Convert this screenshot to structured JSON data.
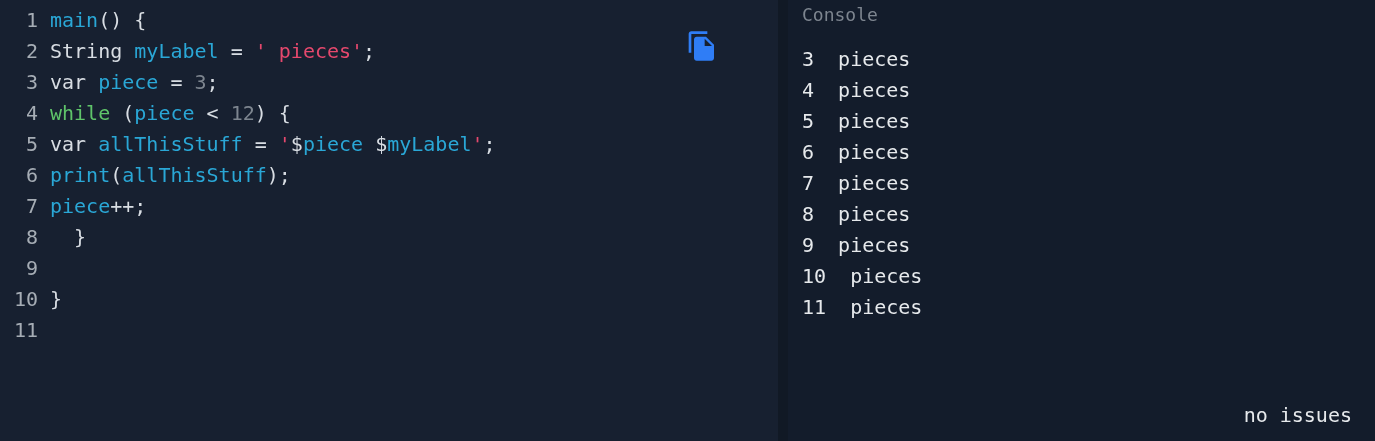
{
  "editor": {
    "lines": [
      {
        "number": "1",
        "tokens": [
          {
            "kind": "ident",
            "text": "main"
          },
          {
            "kind": "plain",
            "text": "() {"
          }
        ]
      },
      {
        "number": "2",
        "tokens": [
          {
            "kind": "plain",
            "text": "String "
          },
          {
            "kind": "ident",
            "text": "myLabel"
          },
          {
            "kind": "plain",
            "text": " = "
          },
          {
            "kind": "string",
            "text": "' pieces'"
          },
          {
            "kind": "plain",
            "text": ";"
          }
        ]
      },
      {
        "number": "3",
        "tokens": [
          {
            "kind": "plain",
            "text": "var "
          },
          {
            "kind": "ident",
            "text": "piece"
          },
          {
            "kind": "plain",
            "text": " = "
          },
          {
            "kind": "number",
            "text": "3"
          },
          {
            "kind": "plain",
            "text": ";"
          }
        ]
      },
      {
        "number": "4",
        "tokens": [
          {
            "kind": "keyword",
            "text": "while"
          },
          {
            "kind": "plain",
            "text": " ("
          },
          {
            "kind": "ident",
            "text": "piece"
          },
          {
            "kind": "plain",
            "text": " < "
          },
          {
            "kind": "number",
            "text": "12"
          },
          {
            "kind": "plain",
            "text": ") {"
          }
        ]
      },
      {
        "number": "5",
        "tokens": [
          {
            "kind": "plain",
            "text": "var "
          },
          {
            "kind": "ident",
            "text": "allThisStuff"
          },
          {
            "kind": "plain",
            "text": " = "
          },
          {
            "kind": "string",
            "text": "'"
          },
          {
            "kind": "plain",
            "text": "$"
          },
          {
            "kind": "ident",
            "text": "piece"
          },
          {
            "kind": "plain",
            "text": " $"
          },
          {
            "kind": "ident",
            "text": "myLabel"
          },
          {
            "kind": "string",
            "text": "'"
          },
          {
            "kind": "plain",
            "text": ";"
          }
        ]
      },
      {
        "number": "6",
        "tokens": [
          {
            "kind": "ident",
            "text": "print"
          },
          {
            "kind": "plain",
            "text": "("
          },
          {
            "kind": "ident",
            "text": "allThisStuff"
          },
          {
            "kind": "plain",
            "text": ");"
          }
        ]
      },
      {
        "number": "7",
        "tokens": [
          {
            "kind": "ident",
            "text": "piece"
          },
          {
            "kind": "plain",
            "text": "++;"
          }
        ]
      },
      {
        "number": "8",
        "tokens": [
          {
            "kind": "plain",
            "text": "  }"
          }
        ]
      },
      {
        "number": "9"
      },
      {
        "number": "10",
        "tokens": [
          {
            "kind": "plain",
            "text": "}"
          }
        ]
      },
      {
        "number": "11"
      }
    ]
  },
  "console": {
    "title": "Console",
    "output": [
      "3  pieces",
      "4  pieces",
      "5  pieces",
      "6  pieces",
      "7  pieces",
      "8  pieces",
      "9  pieces",
      "10  pieces",
      "11  pieces"
    ],
    "status": "no issues"
  }
}
